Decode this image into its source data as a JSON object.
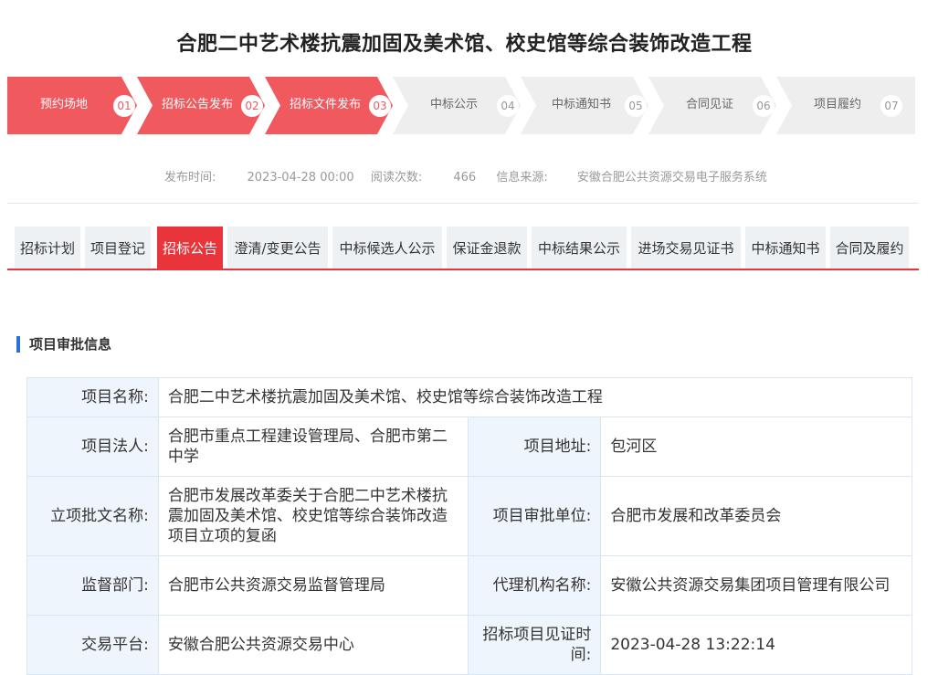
{
  "page": {
    "title": "合肥二中艺术楼抗震加固及美术馆、校史馆等综合装饰改造工程"
  },
  "steps": [
    {
      "label": "预约场地",
      "num": "01",
      "state": "done"
    },
    {
      "label": "招标公告发布",
      "num": "02",
      "state": "done"
    },
    {
      "label": "招标文件发布",
      "num": "03",
      "state": "done"
    },
    {
      "label": "中标公示",
      "num": "04",
      "state": "todo"
    },
    {
      "label": "中标通知书",
      "num": "05",
      "state": "todo"
    },
    {
      "label": "合同见证",
      "num": "06",
      "state": "todo"
    },
    {
      "label": "项目履约",
      "num": "07",
      "state": "todo"
    }
  ],
  "colors": {
    "step_done": "#f05a5f",
    "step_todo": "#eeeeee",
    "accent": "#e8343a",
    "section_bar": "#2a6fd6"
  },
  "meta": {
    "publish_label": "发布时间:",
    "publish_value": "2023-04-28 00:00",
    "views_label": "阅读次数:",
    "views_value": "466",
    "source_label": "信息来源:",
    "source_value": "安徽合肥公共资源交易电子服务系统"
  },
  "tabs": [
    "招标计划",
    "项目登记",
    "招标公告",
    "澄清/变更公告",
    "中标候选人公示",
    "保证金退款",
    "中标结果公示",
    "进场交易见证书",
    "中标通知书",
    "合同及履约"
  ],
  "active_tab": "招标公告",
  "section": {
    "title": "项目审批信息"
  },
  "info": {
    "name_label": "项目名称:",
    "name_value": "合肥二中艺术楼抗震加固及美术馆、校史馆等综合装饰改造工程",
    "legal_label": "项目法人:",
    "legal_value": "合肥市重点工程建设管理局、合肥市第二中学",
    "address_label": "项目地址:",
    "address_value": "包河区",
    "approval_doc_label": "立项批文名称:",
    "approval_doc_value": "合肥市发展改革委关于合肥二中艺术楼抗震加固及美术馆、校史馆等综合装饰改造项目立项的复函",
    "approval_unit_label": "项目审批单位:",
    "approval_unit_value": "合肥市发展和改革委员会",
    "supervisor_label": "监督部门:",
    "supervisor_value": "合肥市公共资源交易监督管理局",
    "agency_label": "代理机构名称:",
    "agency_value": "安徽公共资源交易集团项目管理有限公司",
    "platform_label": "交易平台:",
    "platform_value": "安徽合肥公共资源交易中心",
    "witness_time_label": "招标项目见证时间:",
    "witness_time_value": "2023-04-28 13:22:14"
  }
}
